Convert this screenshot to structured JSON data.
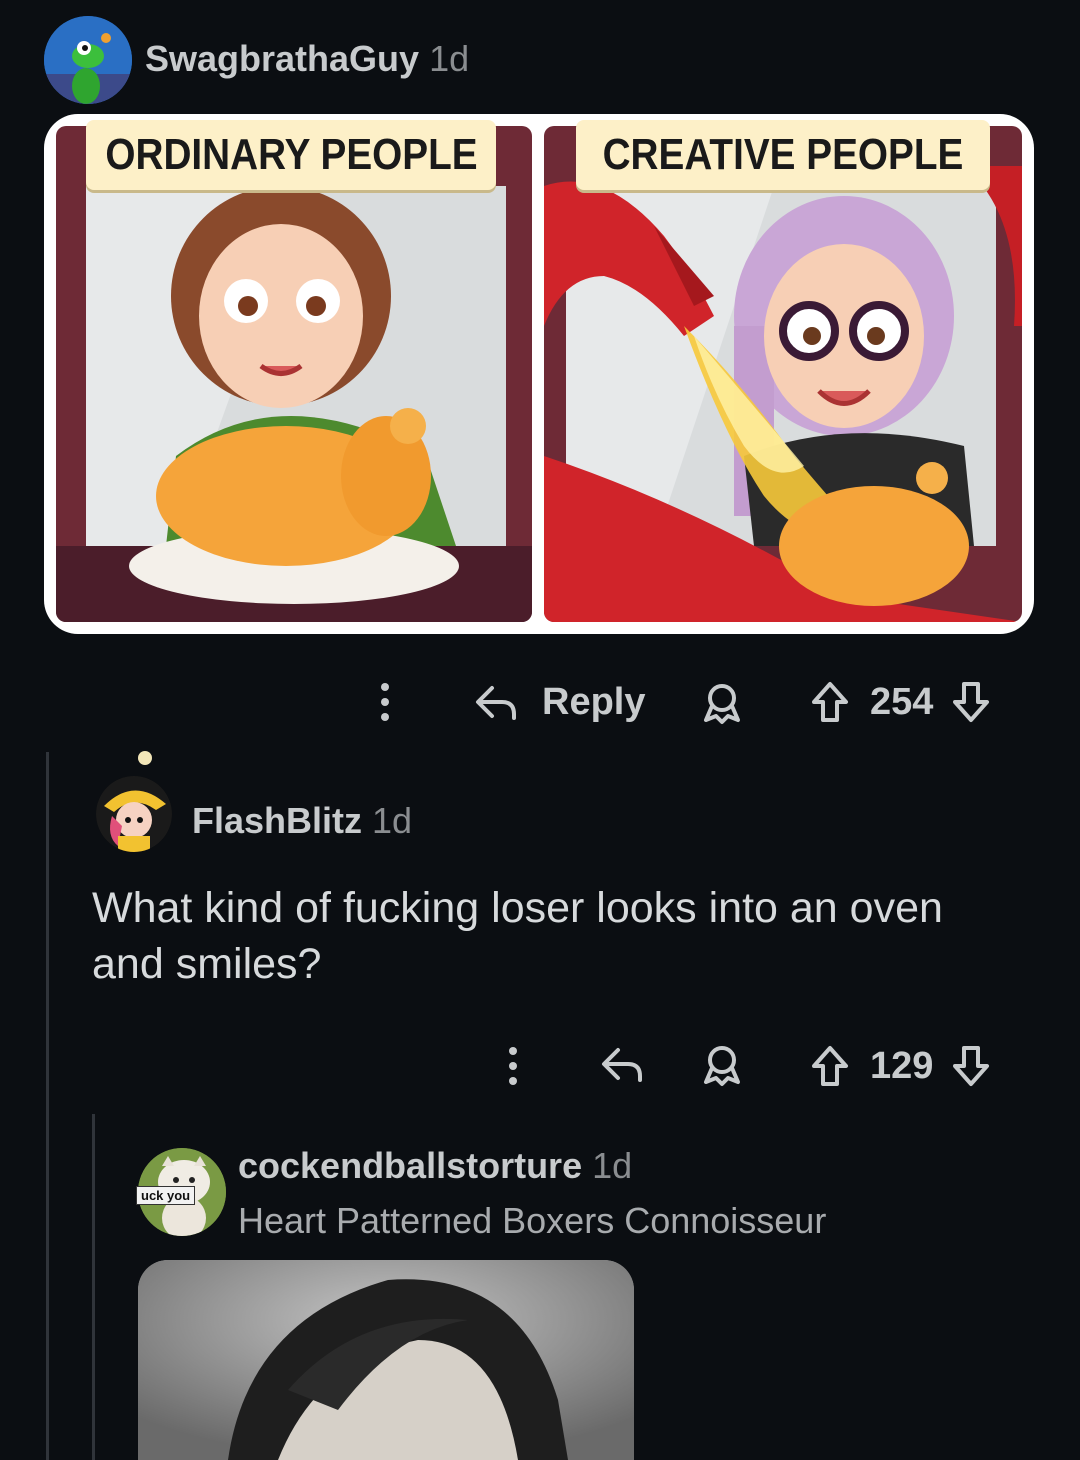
{
  "comments": [
    {
      "username": "SwagbrathaGuy",
      "age": "1d",
      "image": {
        "left_caption": "ORDINARY PEOPLE",
        "right_caption": "CREATIVE PEOPLE"
      },
      "actions": {
        "reply_label": "Reply",
        "score": "254"
      }
    },
    {
      "username": "FlashBlitz",
      "age": "1d",
      "text": "What kind of fucking loser looks into an oven and smiles?",
      "actions": {
        "score": "129"
      }
    },
    {
      "username": "cockendballstorture",
      "age": "1d",
      "flair": "Heart Patterned Boxers Connoisseur",
      "avatar_text": "uck you"
    }
  ],
  "icons": [
    "more-options-icon",
    "reply-icon",
    "award-icon",
    "upvote-icon",
    "downvote-icon"
  ],
  "colors": {
    "background": "#0b0e12",
    "text": "#d7dadc",
    "muted": "#8a8d90"
  }
}
